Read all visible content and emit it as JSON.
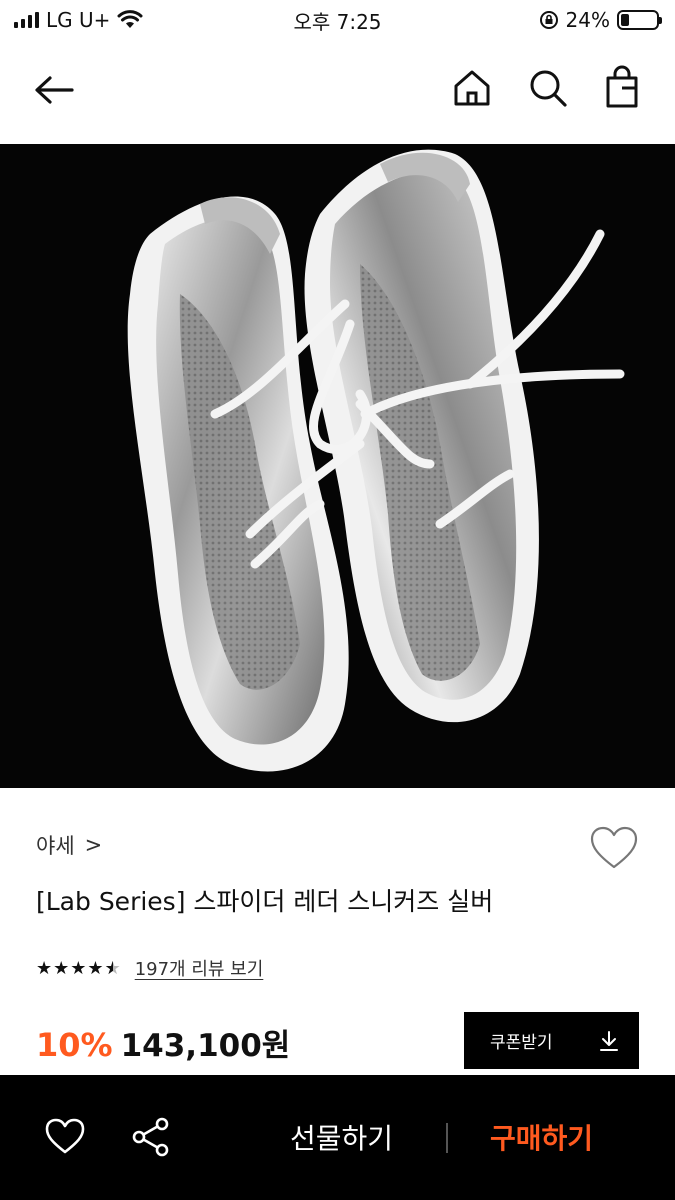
{
  "status_bar": {
    "carrier": "LG U+",
    "time": "오후 7:25",
    "battery_percent": "24%",
    "battery_level": 0.24,
    "icons": [
      "signal-icon",
      "wifi-icon",
      "rotation-lock-icon",
      "battery-icon"
    ]
  },
  "nav": {
    "icons": [
      "back-arrow-icon",
      "home-icon",
      "search-icon",
      "shopping-bag-icon"
    ]
  },
  "product": {
    "image_alt": "silver leather sneakers",
    "brand": "야세",
    "brand_chevron": ">",
    "title": "[Lab Series] 스파이더 레더 스니커즈 실버",
    "rating": 4.5,
    "review_link": "197개 리뷰 보기",
    "discount": "10%",
    "price": "143,100원"
  },
  "coupon": {
    "label": "쿠폰받기",
    "icon": "download-icon"
  },
  "bottom_bar": {
    "gift_label": "선물하기",
    "buy_label": "구매하기",
    "icons": [
      "heart-icon",
      "share-icon"
    ]
  },
  "colors": {
    "accent": "#ff5a1f",
    "dark": "#000000"
  }
}
